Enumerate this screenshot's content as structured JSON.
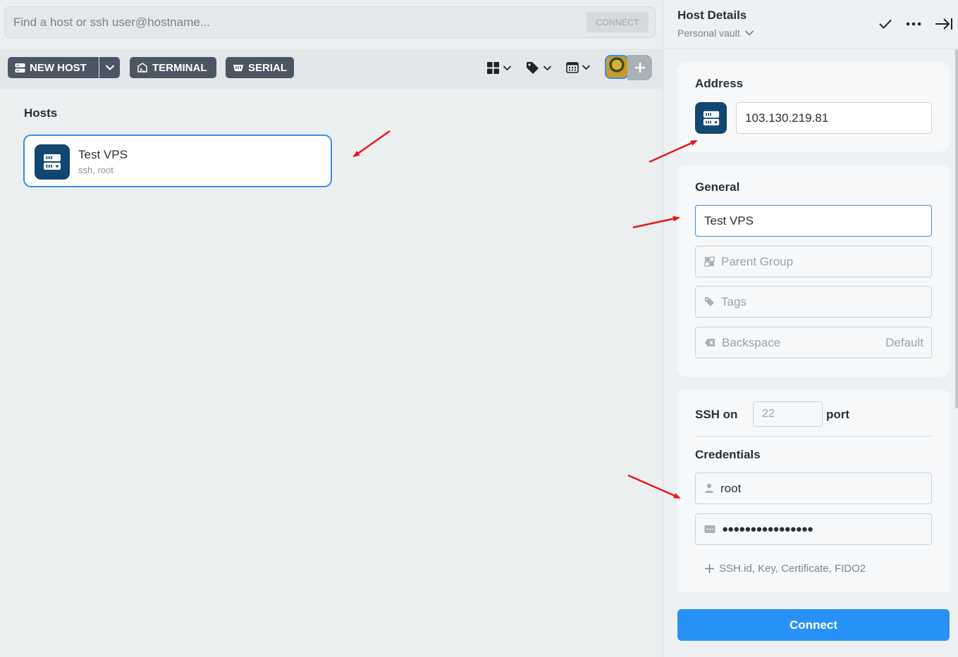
{
  "search": {
    "placeholder": "Find a host or ssh user@hostname...",
    "connect_label": "CONNECT"
  },
  "toolbar": {
    "new_host_label": "NEW HOST",
    "terminal_label": "TERMINAL",
    "serial_label": "SERIAL"
  },
  "hosts": {
    "section_title": "Hosts",
    "items": [
      {
        "name": "Test VPS",
        "sub": "ssh, root"
      }
    ]
  },
  "details": {
    "title": "Host Details",
    "vault": "Personal vault",
    "address": {
      "label": "Address",
      "value": "103.130.219.81"
    },
    "general": {
      "label": "General",
      "label_value": "Test VPS",
      "parent_group_placeholder": "Parent Group",
      "tags_placeholder": "Tags",
      "backspace_label": "Backspace",
      "backspace_value": "Default"
    },
    "ssh": {
      "prefix": "SSH on",
      "port_placeholder": "22",
      "suffix": "port"
    },
    "credentials": {
      "label": "Credentials",
      "username": "root",
      "password_mask": "●●●●●●●●●●●●●●●●",
      "add_label": "SSH.id, Key, Certificate, FIDO2"
    },
    "connect_label": "Connect"
  },
  "colors": {
    "accent": "#2891f5",
    "host_icon_bg": "#124771",
    "toolbar_button_bg": "#4b5664",
    "annotation_arrow": "#e8171b"
  }
}
